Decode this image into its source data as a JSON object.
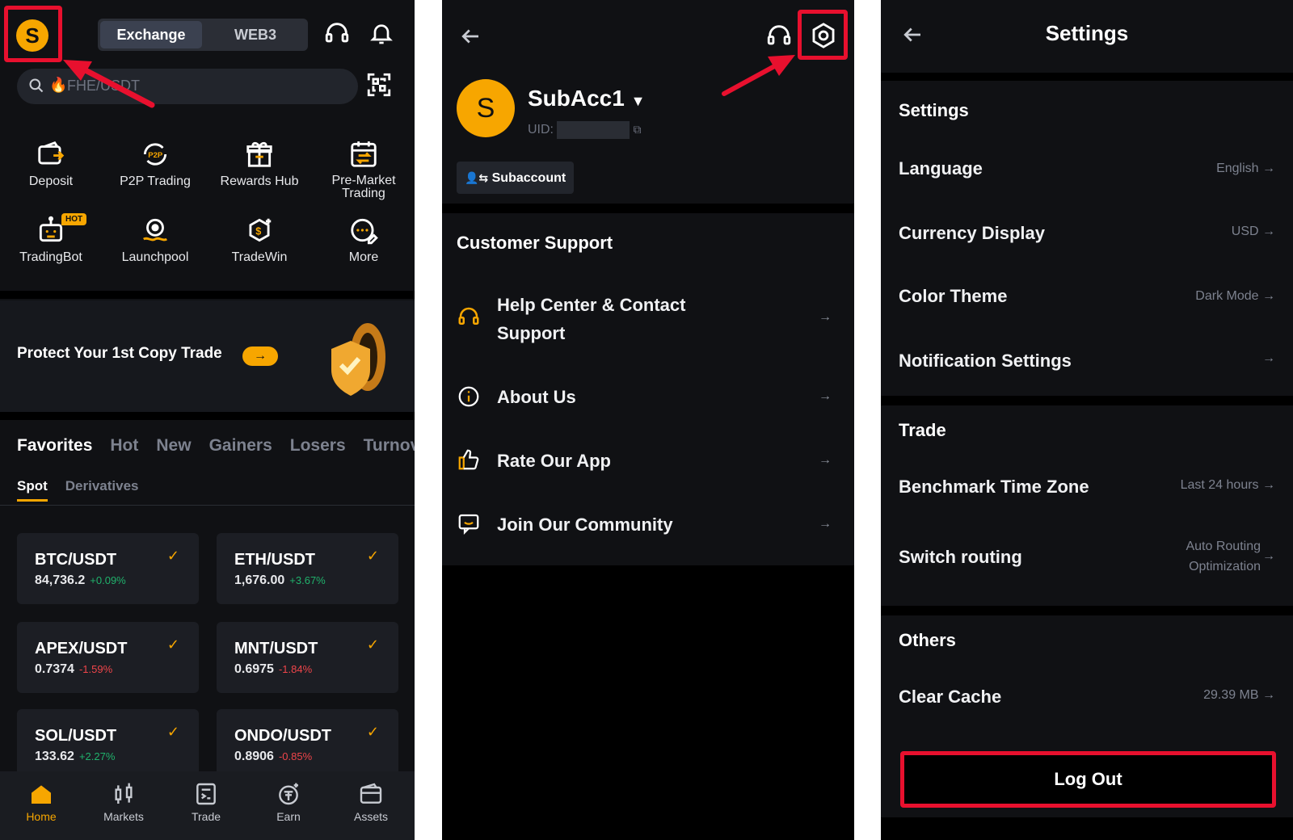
{
  "home": {
    "avatar_letter": "S",
    "segment": {
      "exchange": "Exchange",
      "web3": "WEB3"
    },
    "search_placeholder": "FHE/USDT",
    "quick_actions": [
      {
        "label": "Deposit",
        "icon": "deposit-icon"
      },
      {
        "label": "P2P Trading",
        "icon": "p2p-icon"
      },
      {
        "label": "Rewards Hub",
        "icon": "gift-icon"
      },
      {
        "label": "Pre-Market Trading",
        "icon": "calendar-exchange-icon"
      },
      {
        "label": "TradingBot",
        "icon": "robot-icon",
        "badge": "HOT"
      },
      {
        "label": "Launchpool",
        "icon": "launchpool-icon"
      },
      {
        "label": "TradeWin",
        "icon": "tradewin-icon"
      },
      {
        "label": "More",
        "icon": "more-icon"
      }
    ],
    "promo": {
      "title": "Protect Your 1st Copy Trade"
    },
    "tabs": [
      "Favorites",
      "Hot",
      "New",
      "Gainers",
      "Losers",
      "Turnov"
    ],
    "subtabs": [
      "Spot",
      "Derivatives"
    ],
    "favorites": [
      {
        "pair": "BTC/USDT",
        "price": "84,736.2",
        "change": "+0.09%",
        "dir": "up"
      },
      {
        "pair": "ETH/USDT",
        "price": "1,676.00",
        "change": "+3.67%",
        "dir": "up"
      },
      {
        "pair": "APEX/USDT",
        "price": "0.7374",
        "change": "-1.59%",
        "dir": "down"
      },
      {
        "pair": "MNT/USDT",
        "price": "0.6975",
        "change": "-1.84%",
        "dir": "down"
      },
      {
        "pair": "SOL/USDT",
        "price": "133.62",
        "change": "+2.27%",
        "dir": "up"
      },
      {
        "pair": "ONDO/USDT",
        "price": "0.8906",
        "change": "-0.85%",
        "dir": "down"
      }
    ],
    "bottom_nav": [
      "Home",
      "Markets",
      "Trade",
      "Earn",
      "Assets"
    ]
  },
  "profile": {
    "avatar_letter": "S",
    "name": "SubAcc1",
    "uid_label": "UID:",
    "subaccount_label": "Subaccount",
    "support_title": "Customer Support",
    "rows": [
      {
        "label": "Help Center & Contact Support",
        "icon": "headset-icon"
      },
      {
        "label": "About Us",
        "icon": "info-icon"
      },
      {
        "label": "Rate Our App",
        "icon": "thumbs-up-icon"
      },
      {
        "label": "Join Our Community",
        "icon": "chat-icon"
      }
    ]
  },
  "settings": {
    "title": "Settings",
    "section_settings": "Settings",
    "settings_rows": [
      {
        "label": "Language",
        "value": "English"
      },
      {
        "label": "Currency Display",
        "value": "USD"
      },
      {
        "label": "Color Theme",
        "value": "Dark Mode"
      },
      {
        "label": "Notification Settings",
        "value": ""
      }
    ],
    "section_trade": "Trade",
    "trade_rows": [
      {
        "label": "Benchmark Time Zone",
        "value": "Last 24 hours"
      },
      {
        "label": "Switch routing",
        "value": "Auto Routing Optimization"
      }
    ],
    "section_others": "Others",
    "others_rows": [
      {
        "label": "Clear Cache",
        "value": "29.39 MB"
      }
    ],
    "logout_label": "Log Out"
  },
  "colors": {
    "accent": "#f7a600",
    "highlight": "#e8102e",
    "up": "#20b26c",
    "down": "#ef454a"
  }
}
